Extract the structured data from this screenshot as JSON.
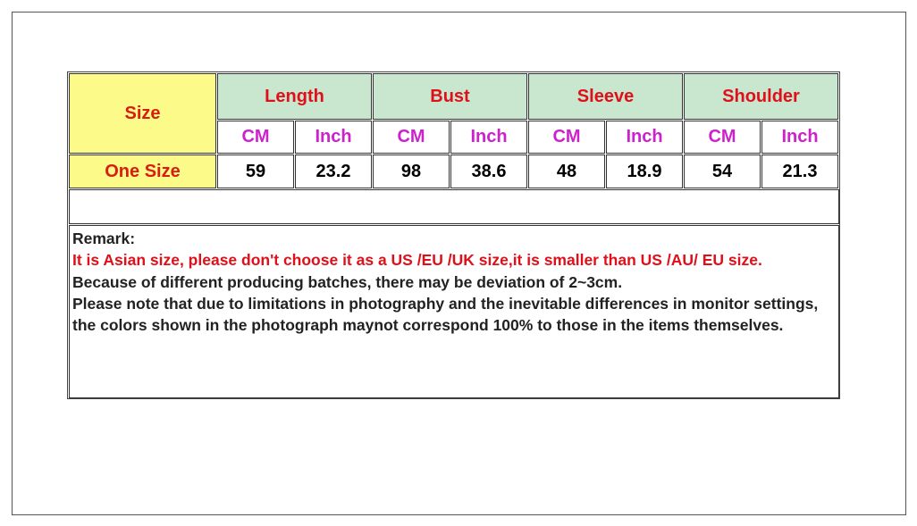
{
  "header": {
    "size": "Size",
    "groups": [
      "Length",
      "Bust",
      "Sleeve",
      "Shoulder"
    ],
    "units": [
      "CM",
      "Inch"
    ]
  },
  "rows": [
    {
      "label": "One Size",
      "values": [
        "59",
        "23.2",
        "98",
        "38.6",
        "48",
        "18.9",
        "54",
        "21.3"
      ]
    }
  ],
  "remark": {
    "title": "Remark:",
    "warning": "It is Asian size, please don't choose it as a US /EU /UK size,it is smaller than US /AU/ EU size.",
    "lines": [
      "Because of different producing batches, there may be deviation of 2~3cm.",
      "Please note that  due to limitations in photography and the inevitable  differences in monitor settings, the colors shown in the  photograph maynot correspond 100% to those in the items themselves."
    ]
  },
  "colors": {
    "size_bg": "#fcfb8a",
    "header_bg": "#c9e6cf",
    "header_text": "#e0101a",
    "unit_text": "#cc22cc"
  }
}
